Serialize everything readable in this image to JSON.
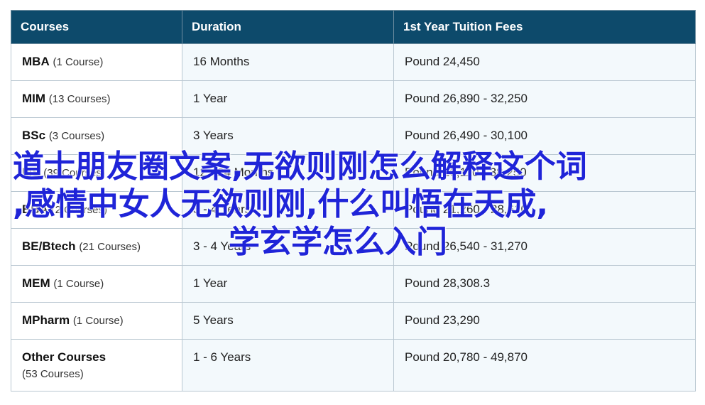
{
  "table": {
    "headers": [
      "Courses",
      "Duration",
      "1st Year Tuition Fees"
    ],
    "rows": [
      {
        "name": "MBA",
        "count": "(1 Course)",
        "duration": "16 Months",
        "fees": "Pound 24,450"
      },
      {
        "name": "MIM",
        "count": "(13 Courses)",
        "duration": "1 Year",
        "fees": "Pound 26,890 - 32,250"
      },
      {
        "name": "BSc",
        "count": "(3 Courses)",
        "duration": "3 Years",
        "fees": "Pound 26,490 - 30,100"
      },
      {
        "name": "MS",
        "count": "(39 Courses)",
        "duration": "12 - 24 Months",
        "fees": "Pound 20,110 - 38,250"
      },
      {
        "name": "BBA",
        "count": "(2 Courses)",
        "duration": "3 - 4 Years",
        "fees": "Pound 21,260 - 28,610"
      },
      {
        "name": "BE/Btech",
        "count": "(21 Courses)",
        "duration": "3 - 4 Years",
        "fees": "Pound 26,540 - 31,270"
      },
      {
        "name": "MEM",
        "count": "(1 Course)",
        "duration": "1 Year",
        "fees": "Pound 28,308.3"
      },
      {
        "name": "MPharm",
        "count": "(1 Course)",
        "duration": "5 Years",
        "fees": "Pound 23,290"
      },
      {
        "name": "Other Courses",
        "count": "(53 Courses)",
        "duration": "1 - 6 Years",
        "fees": "Pound 20,780 - 49,870"
      }
    ]
  },
  "overlay": {
    "line1": "道士朋友圈文案,无欲则刚怎么解释这个词",
    "line2": ",感情中女人无欲则刚,什么叫悟在天成,",
    "line3": "学玄学怎么入门"
  }
}
